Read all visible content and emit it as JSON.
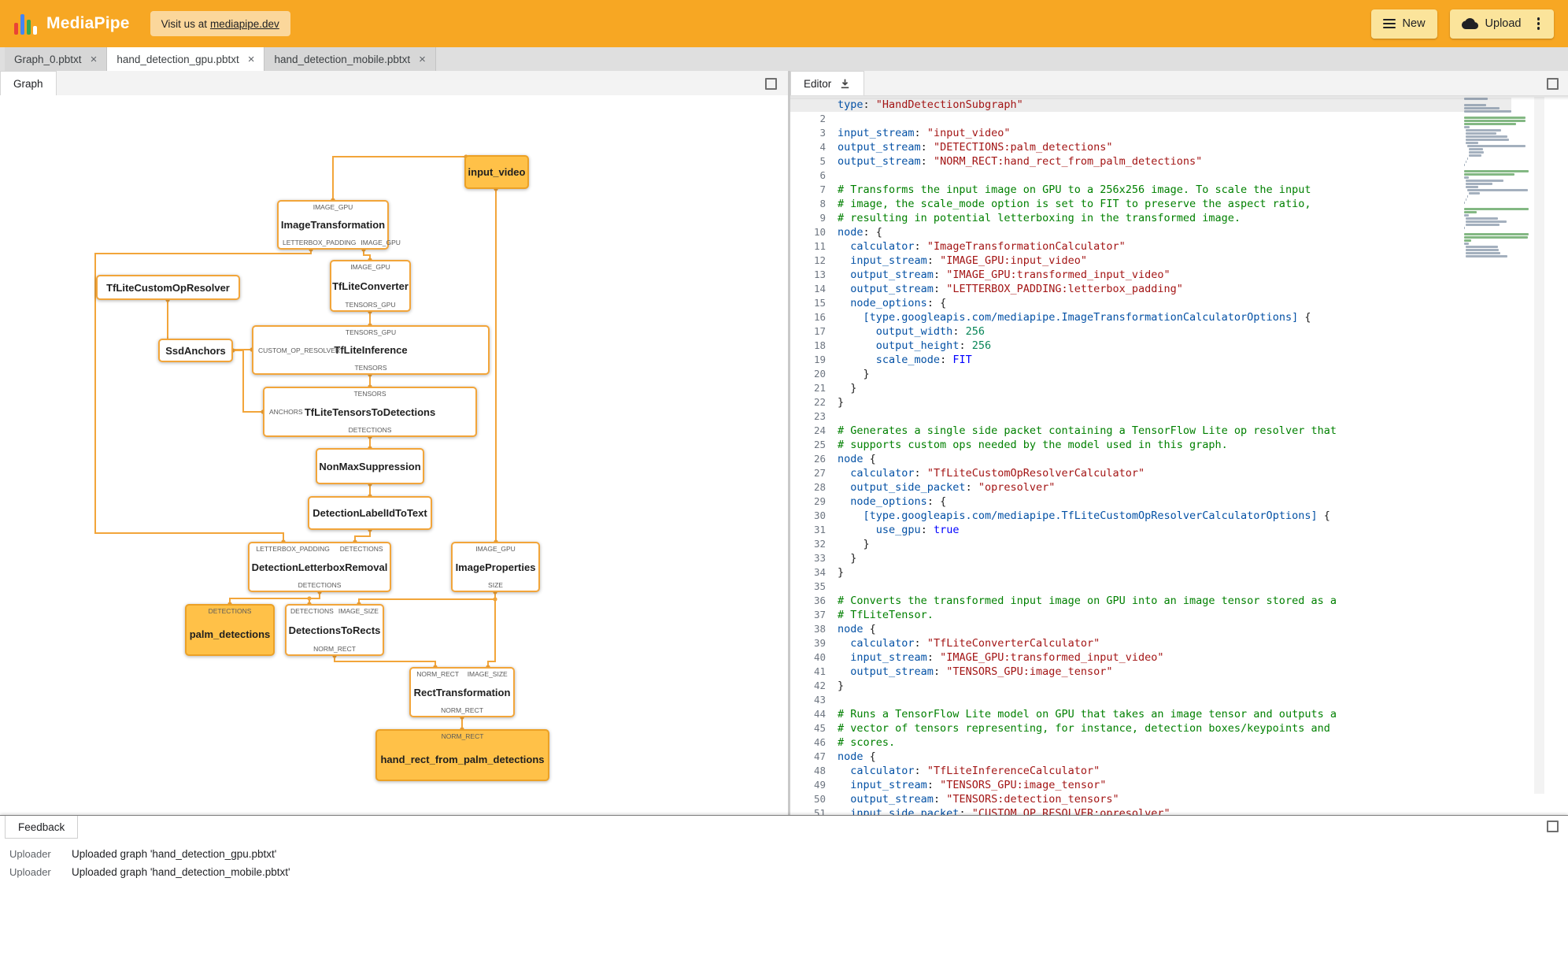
{
  "header": {
    "brand": "MediaPipe",
    "visit_text": "Visit us at",
    "visit_link": "mediapipe.dev",
    "new_label": "New",
    "upload_label": "Upload"
  },
  "ui": {
    "close_glyph": "×"
  },
  "colors": {
    "header_bar": "#F7A723",
    "header_button": "#FBE49B",
    "edge_accent": "#F2A53A",
    "stream_node_fill": "#FFC148"
  },
  "file_tabs": [
    {
      "label": "Graph_0.pbtxt",
      "active": false
    },
    {
      "label": "hand_detection_gpu.pbtxt",
      "active": true
    },
    {
      "label": "hand_detection_mobile.pbtxt",
      "active": false
    }
  ],
  "panels": {
    "graph_tab": "Graph",
    "editor_tab": "Editor",
    "feedback_tab": "Feedback"
  },
  "feedback": {
    "entries": [
      {
        "source": "Uploader",
        "message": "Uploaded graph 'hand_detection_gpu.pbtxt'"
      },
      {
        "source": "Uploader",
        "message": "Uploaded graph 'hand_detection_mobile.pbtxt'"
      }
    ]
  },
  "graph": {
    "nodes": [
      {
        "title": "input_video",
        "type": "stream"
      },
      {
        "title": "ImageTransformation",
        "ports_top": [
          "IMAGE_GPU"
        ],
        "ports_bottom": [
          "LETTERBOX_PADDING",
          "IMAGE_GPU"
        ]
      },
      {
        "title": "TfLiteConverter",
        "ports_top": [
          "IMAGE_GPU"
        ],
        "ports_bottom": [
          "TENSORS_GPU"
        ]
      },
      {
        "title": "TfLiteCustomOpResolver"
      },
      {
        "title": "SsdAnchors"
      },
      {
        "title": "TfLiteInference",
        "ports_top": [
          "TENSORS_GPU"
        ],
        "port_left": "CUSTOM_OP_RESOLVER",
        "ports_bottom": [
          "TENSORS"
        ]
      },
      {
        "title": "TfLiteTensorsToDetections",
        "ports_top": [
          "TENSORS"
        ],
        "port_left": "ANCHORS",
        "ports_bottom": [
          "DETECTIONS"
        ]
      },
      {
        "title": "NonMaxSuppression"
      },
      {
        "title": "DetectionLabelIdToText"
      },
      {
        "title": "DetectionLetterboxRemoval",
        "ports_top": [
          "LETTERBOX_PADDING",
          "DETECTIONS"
        ],
        "ports_bottom": [
          "DETECTIONS"
        ]
      },
      {
        "title": "ImageProperties",
        "ports_top": [
          "IMAGE_GPU"
        ],
        "ports_bottom": [
          "SIZE"
        ]
      },
      {
        "title": "palm_detections",
        "type": "stream",
        "ports_top": [
          "DETECTIONS"
        ]
      },
      {
        "title": "DetectionsToRects",
        "ports_top": [
          "DETECTIONS",
          "IMAGE_SIZE"
        ],
        "ports_bottom": [
          "NORM_RECT"
        ]
      },
      {
        "title": "RectTransformation",
        "ports_top": [
          "NORM_RECT",
          "IMAGE_SIZE"
        ],
        "ports_bottom": [
          "NORM_RECT"
        ]
      },
      {
        "title": "hand_rect_from_palm_detections",
        "type": "stream",
        "ports_top": [
          "NORM_RECT"
        ]
      }
    ]
  },
  "editor": {
    "lines": [
      "type: \"HandDetectionSubgraph\"",
      "",
      "input_stream: \"input_video\"",
      "output_stream: \"DETECTIONS:palm_detections\"",
      "output_stream: \"NORM_RECT:hand_rect_from_palm_detections\"",
      "",
      "# Transforms the input image on GPU to a 256x256 image. To scale the input",
      "# image, the scale_mode option is set to FIT to preserve the aspect ratio,",
      "# resulting in potential letterboxing in the transformed image.",
      "node: {",
      "  calculator: \"ImageTransformationCalculator\"",
      "  input_stream: \"IMAGE_GPU:input_video\"",
      "  output_stream: \"IMAGE_GPU:transformed_input_video\"",
      "  output_stream: \"LETTERBOX_PADDING:letterbox_padding\"",
      "  node_options: {",
      "    [type.googleapis.com/mediapipe.ImageTransformationCalculatorOptions] {",
      "      output_width: 256",
      "      output_height: 256",
      "      scale_mode: FIT",
      "    }",
      "  }",
      "}",
      "",
      "# Generates a single side packet containing a TensorFlow Lite op resolver that",
      "# supports custom ops needed by the model used in this graph.",
      "node {",
      "  calculator: \"TfLiteCustomOpResolverCalculator\"",
      "  output_side_packet: \"opresolver\"",
      "  node_options: {",
      "    [type.googleapis.com/mediapipe.TfLiteCustomOpResolverCalculatorOptions] {",
      "      use_gpu: true",
      "    }",
      "  }",
      "}",
      "",
      "# Converts the transformed input image on GPU into an image tensor stored as a",
      "# TfLiteTensor.",
      "node {",
      "  calculator: \"TfLiteConverterCalculator\"",
      "  input_stream: \"IMAGE_GPU:transformed_input_video\"",
      "  output_stream: \"TENSORS_GPU:image_tensor\"",
      "}",
      "",
      "# Runs a TensorFlow Lite model on GPU that takes an image tensor and outputs a",
      "# vector of tensors representing, for instance, detection boxes/keypoints and",
      "# scores.",
      "node {",
      "  calculator: \"TfLiteInferenceCalculator\"",
      "  input_stream: \"TENSORS_GPU:image_tensor\"",
      "  output_stream: \"TENSORS:detection_tensors\"",
      "  input_side_packet: \"CUSTOM_OP_RESOLVER:opresolver\""
    ]
  }
}
